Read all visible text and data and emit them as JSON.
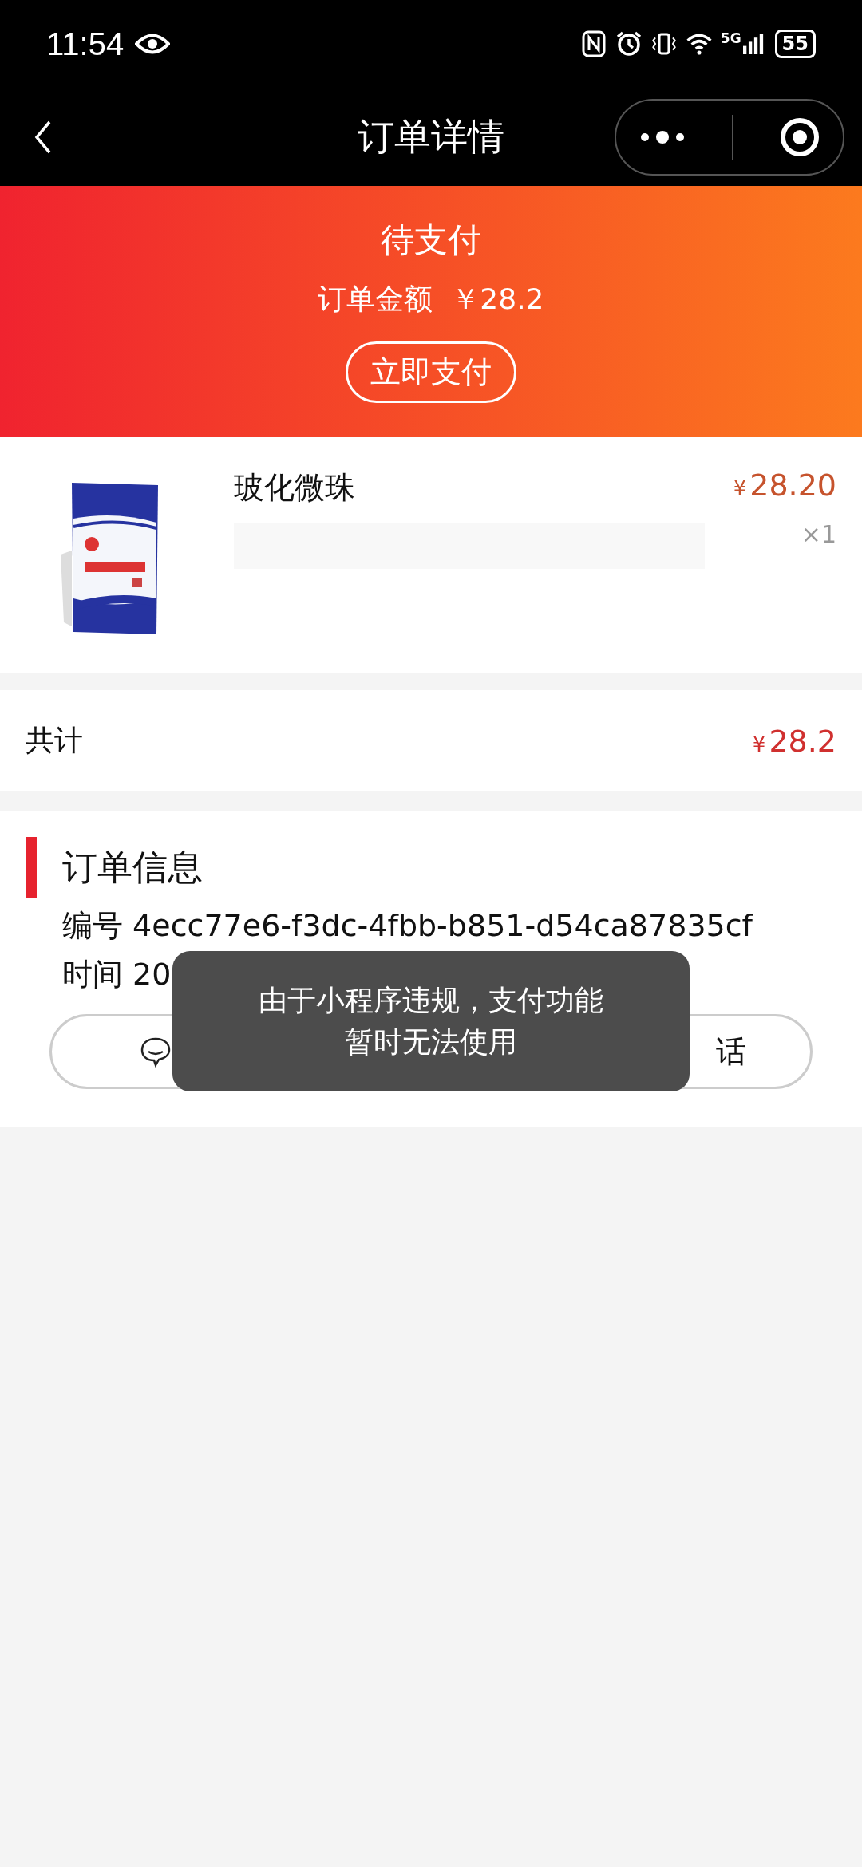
{
  "status_bar": {
    "time": "11:54",
    "network": "5G",
    "battery": "55"
  },
  "nav": {
    "title": "订单详情"
  },
  "banner": {
    "status": "待支付",
    "amount_label": "订单金额",
    "amount": "￥28.2",
    "pay_button": "立即支付"
  },
  "product": {
    "kind": "picture",
    "name": "玻化微珠",
    "currency": "¥",
    "price": "28.20",
    "quantity": "×1"
  },
  "total": {
    "label": "共计",
    "currency": "¥",
    "amount": "28.2"
  },
  "order_info": {
    "title": "订单信息",
    "number_label": "编号",
    "number": "4ecc77e6-f3dc-4fbb-b851-d54ca87835cf",
    "time_label": "时间",
    "time": "20"
  },
  "buttons": [
    {
      "kind": "chat"
    },
    {
      "kind": "phone",
      "label": "话"
    }
  ],
  "toast": {
    "message": "由于小程序违规，支付功能暂时无法使用"
  }
}
